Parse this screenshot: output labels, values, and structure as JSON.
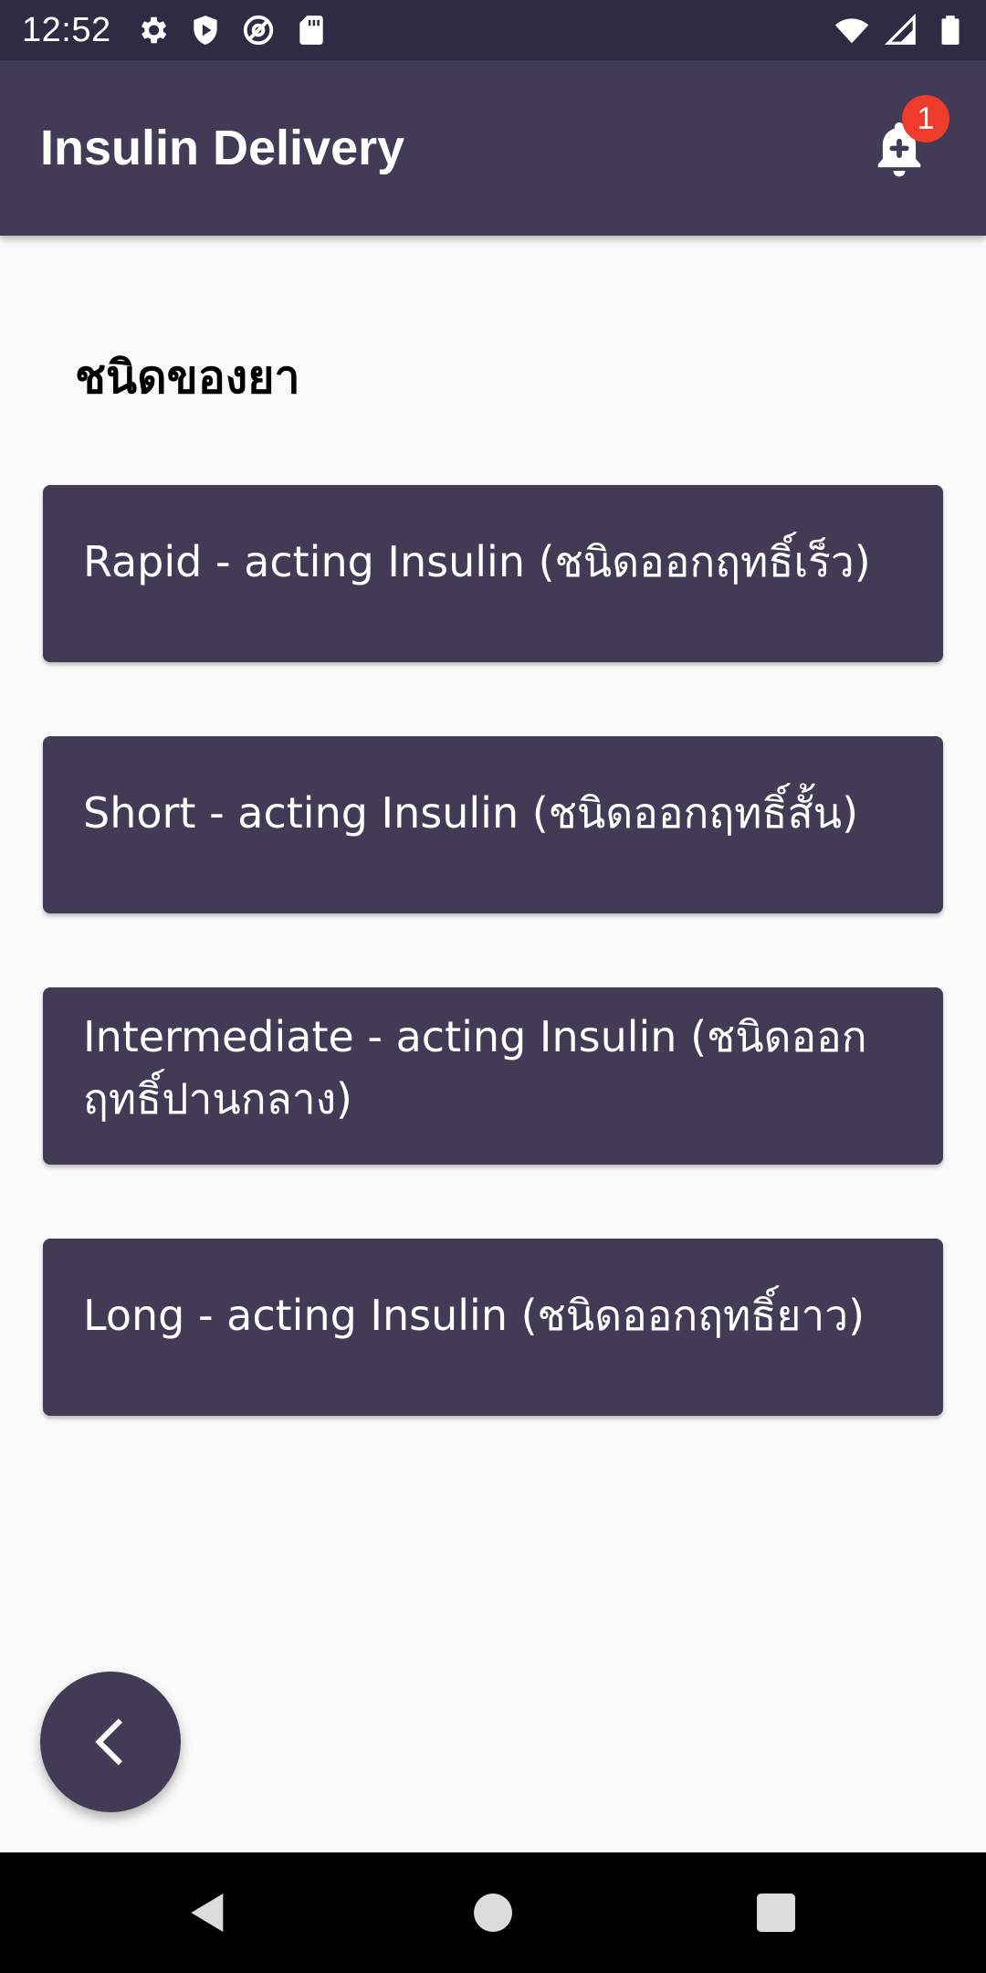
{
  "status_bar": {
    "time": "12:52",
    "left_icons": [
      "gear-icon",
      "shield-icon",
      "at-sign-icon",
      "sd-card-icon"
    ],
    "right_icons": [
      "wifi-icon",
      "cell-signal-icon",
      "battery-icon"
    ]
  },
  "app_bar": {
    "title": "Insulin Delivery",
    "notification_count": "1",
    "notification_icon": "bell-plus-icon"
  },
  "content": {
    "section_title": "ชนิดของยา",
    "items": [
      {
        "label": "Rapid - acting Insulin (ชนิดออกฤทธิ์เร็ว)"
      },
      {
        "label": "Short - acting Insulin (ชนิดออกฤทธิ์สั้น)"
      },
      {
        "label": "Intermediate - acting Insulin (ชนิดออกฤทธิ์ปานกลาง)"
      },
      {
        "label": "Long - acting Insulin (ชนิดออกฤทธิ์ยาว)"
      }
    ]
  },
  "fab": {
    "icon": "chevron-left-icon"
  },
  "nav_bar": {
    "icons": [
      "back-triangle-icon",
      "home-circle-icon",
      "recents-square-icon"
    ]
  },
  "colors": {
    "status_bar": "#2e2c43",
    "primary": "#413b56",
    "badge": "#ef3b2c",
    "background": "#fafafa"
  }
}
